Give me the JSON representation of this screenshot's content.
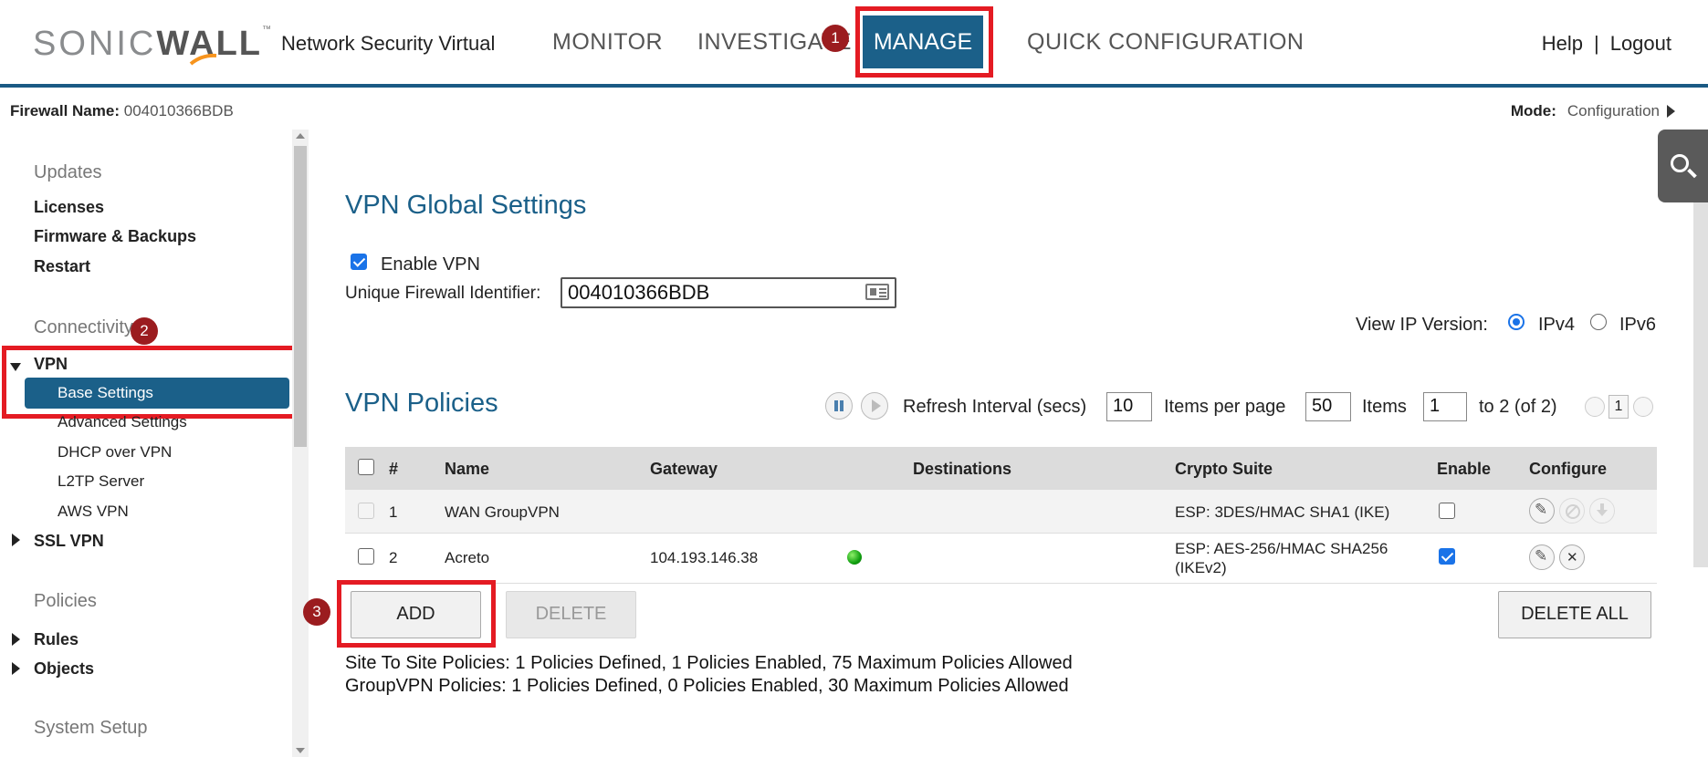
{
  "header": {
    "logo_light": "SONIC",
    "logo_bold": "WALL",
    "logo_tm": "™",
    "product": "Network Security Virtual",
    "nav": [
      "MONITOR",
      "INVESTIGATE",
      "MANAGE",
      "QUICK CONFIGURATION"
    ],
    "help": "Help",
    "separator": "|",
    "logout": "Logout",
    "accent_color": "#1b6089"
  },
  "annotations": [
    "1",
    "2",
    "3"
  ],
  "infobar": {
    "fw_label": "Firewall Name:",
    "fw_value": "004010366BDB",
    "mode_label": "Mode:",
    "mode_value": "Configuration"
  },
  "sidebar": {
    "group_updates": "Updates",
    "licenses": "Licenses",
    "firmware": "Firmware & Backups",
    "restart": "Restart",
    "group_connectivity": "Connectivity",
    "vpn": "VPN",
    "base_settings": "Base Settings",
    "advanced_settings": "Advanced Settings",
    "dhcp_over_vpn": "DHCP over VPN",
    "l2tp_server": "L2TP Server",
    "aws_vpn": "AWS VPN",
    "ssl_vpn": "SSL VPN",
    "group_policies": "Policies",
    "rules": "Rules",
    "objects": "Objects",
    "group_system_setup": "System Setup"
  },
  "global_settings": {
    "title": "VPN Global Settings",
    "enable_vpn_label": "Enable VPN",
    "enable_vpn_checked": true,
    "uid_label": "Unique Firewall Identifier:",
    "uid_value": "004010366BDB",
    "view_ip_label": "View IP Version:",
    "ipv4": "IPv4",
    "ipv6": "IPv6",
    "ip_selected": "IPv4"
  },
  "policies": {
    "title": "VPN Policies",
    "refresh_label": "Refresh Interval (secs)",
    "refresh_value": "10",
    "per_page_label": "Items per page",
    "per_page_value": "50",
    "items_label": "Items",
    "items_value": "1",
    "range_text": "to 2 (of 2)",
    "page": "1",
    "columns": [
      "#",
      "Name",
      "Gateway",
      "Destinations",
      "Crypto Suite",
      "Enable",
      "Configure"
    ],
    "rows": [
      {
        "num": "1",
        "name": "WAN GroupVPN",
        "gateway": "",
        "crypto_line1": "ESP: 3DES/HMAC SHA1 (IKE)",
        "crypto_line2": "",
        "enabled": false
      },
      {
        "num": "2",
        "name": "Acreto",
        "gateway": "104.193.146.38",
        "crypto_line1": "ESP: AES-256/HMAC SHA256",
        "crypto_line2": "(IKEv2)",
        "enabled": true
      }
    ],
    "add": "ADD",
    "delete": "DELETE",
    "delete_all": "DELETE ALL",
    "site_to_site": "Site To Site Policies: 1 Policies Defined, 1 Policies Enabled, 75 Maximum Policies Allowed",
    "groupvpn": "GroupVPN Policies: 1 Policies Defined, 0 Policies Enabled, 30 Maximum Policies Allowed"
  }
}
